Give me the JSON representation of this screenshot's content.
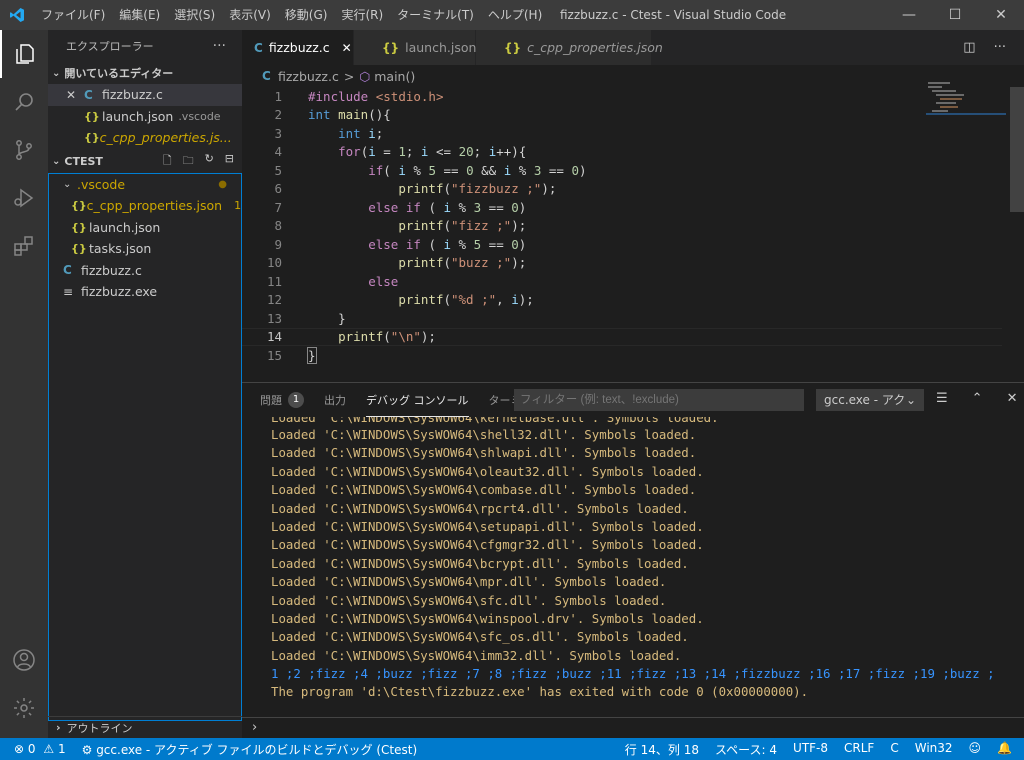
{
  "window": {
    "title": "fizzbuzz.c - Ctest - Visual Studio Code"
  },
  "menu": [
    "ファイル(F)",
    "編集(E)",
    "選択(S)",
    "表示(V)",
    "移動(G)",
    "実行(R)",
    "ターミナル(T)",
    "ヘルプ(H)"
  ],
  "sidebar": {
    "title": "エクスプローラー",
    "more": "···",
    "open_editors": {
      "header": "開いているエディター",
      "items": [
        {
          "name": "fizzbuzz.c",
          "close": "✕"
        },
        {
          "name": "launch.json",
          "hint": ".vscode"
        },
        {
          "name": "c_cpp_properties.js...",
          "count": "1"
        }
      ]
    },
    "workspace": {
      "header": "CTEST",
      "tree": [
        {
          "name": ".vscode"
        },
        {
          "name": "c_cpp_properties.json",
          "count": "1"
        },
        {
          "name": "launch.json"
        },
        {
          "name": "tasks.json"
        },
        {
          "name": "fizzbuzz.c"
        },
        {
          "name": "fizzbuzz.exe"
        }
      ]
    },
    "outline": "アウトライン"
  },
  "editor": {
    "tabs": [
      {
        "label": "fizzbuzz.c",
        "close": "✕"
      },
      {
        "label": "launch.json"
      },
      {
        "label": "c_cpp_properties.json"
      }
    ],
    "breadcrumb": {
      "file": "fizzbuzz.c",
      "sep": ">",
      "symbol": "main()"
    },
    "line_numbers": [
      "1",
      "2",
      "3",
      "4",
      "5",
      "6",
      "7",
      "8",
      "9",
      "10",
      "11",
      "12",
      "13",
      "14",
      "15"
    ],
    "current_line": "14"
  },
  "panel": {
    "tabs": {
      "problems": "問題",
      "problems_count": "1",
      "output": "出力",
      "debug_console": "デバッグ コンソール",
      "terminal": "ターミナル"
    },
    "filter_placeholder": "フィルター (例: text、!exclude)",
    "dropdown": "gcc.exe - アク",
    "output": [
      "Loaded 'C:\\WINDOWS\\SysWOW64\\shell32.dll'. Symbols loaded.",
      "Loaded 'C:\\WINDOWS\\SysWOW64\\shlwapi.dll'. Symbols loaded.",
      "Loaded 'C:\\WINDOWS\\SysWOW64\\oleaut32.dll'. Symbols loaded.",
      "Loaded 'C:\\WINDOWS\\SysWOW64\\combase.dll'. Symbols loaded.",
      "Loaded 'C:\\WINDOWS\\SysWOW64\\rpcrt4.dll'. Symbols loaded.",
      "Loaded 'C:\\WINDOWS\\SysWOW64\\setupapi.dll'. Symbols loaded.",
      "Loaded 'C:\\WINDOWS\\SysWOW64\\cfgmgr32.dll'. Symbols loaded.",
      "Loaded 'C:\\WINDOWS\\SysWOW64\\bcrypt.dll'. Symbols loaded.",
      "Loaded 'C:\\WINDOWS\\SysWOW64\\mpr.dll'. Symbols loaded.",
      "Loaded 'C:\\WINDOWS\\SysWOW64\\sfc.dll'. Symbols loaded.",
      "Loaded 'C:\\WINDOWS\\SysWOW64\\winspool.drv'. Symbols loaded.",
      "Loaded 'C:\\WINDOWS\\SysWOW64\\sfc_os.dll'. Symbols loaded.",
      "Loaded 'C:\\WINDOWS\\SysWOW64\\imm32.dll'. Symbols loaded.",
      "1 ;2 ;fizz ;4 ;buzz ;fizz ;7 ;8 ;fizz ;buzz ;11 ;fizz ;13 ;14 ;fizzbuzz ;16 ;17 ;fizz ;19 ;buzz ;",
      "The program 'd:\\Ctest\\fizzbuzz.exe' has exited with code 0 (0x00000000)."
    ]
  },
  "statusbar": {
    "errors": "0",
    "warnings": "1",
    "task": "gcc.exe - アクティブ ファイルのビルドとデバッグ (Ctest)",
    "position": "行 14、列 18",
    "spaces": "スペース: 4",
    "encoding": "UTF-8",
    "eol": "CRLF",
    "language": "C",
    "platform": "Win32"
  },
  "colors": {
    "accent": "#007acc",
    "title_bar": "#3c3c3c",
    "activity_bar": "#333333",
    "sidebar": "#252526",
    "editor": "#1e1e1e"
  }
}
